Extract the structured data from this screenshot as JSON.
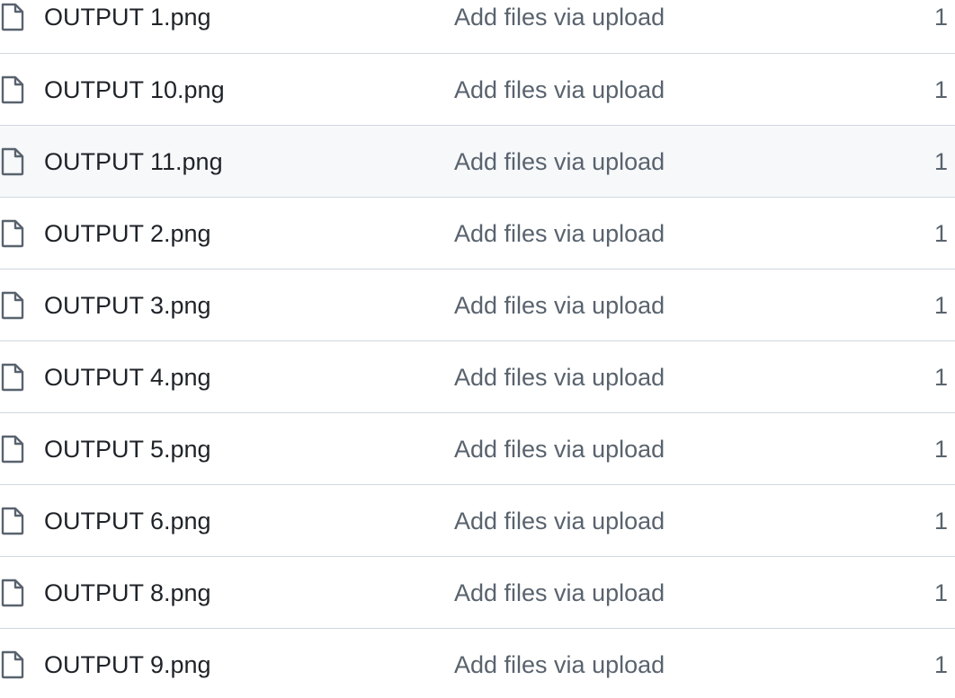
{
  "colors": {
    "text_primary": "#1f2328",
    "text_muted": "#59636e",
    "row_border": "#d0d7de",
    "row_hover": "#f6f8fa"
  },
  "files": [
    {
      "name": "OUTPUT 1.png",
      "message": "Add files via upload",
      "age": "1",
      "icon": "file-icon",
      "hovered": false
    },
    {
      "name": "OUTPUT 10.png",
      "message": "Add files via upload",
      "age": "1",
      "icon": "file-icon",
      "hovered": false
    },
    {
      "name": "OUTPUT 11.png",
      "message": "Add files via upload",
      "age": "1",
      "icon": "file-icon",
      "hovered": true
    },
    {
      "name": "OUTPUT 2.png",
      "message": "Add files via upload",
      "age": "1",
      "icon": "file-icon",
      "hovered": false
    },
    {
      "name": "OUTPUT 3.png",
      "message": "Add files via upload",
      "age": "1",
      "icon": "file-icon",
      "hovered": false
    },
    {
      "name": "OUTPUT 4.png",
      "message": "Add files via upload",
      "age": "1",
      "icon": "file-icon",
      "hovered": false
    },
    {
      "name": "OUTPUT 5.png",
      "message": "Add files via upload",
      "age": "1",
      "icon": "file-icon",
      "hovered": false
    },
    {
      "name": "OUTPUT 6.png",
      "message": "Add files via upload",
      "age": "1",
      "icon": "file-icon",
      "hovered": false
    },
    {
      "name": "OUTPUT 8.png",
      "message": "Add files via upload",
      "age": "1",
      "icon": "file-icon",
      "hovered": false
    },
    {
      "name": "OUTPUT 9.png",
      "message": "Add files via upload",
      "age": "1",
      "icon": "file-icon",
      "hovered": false
    }
  ]
}
